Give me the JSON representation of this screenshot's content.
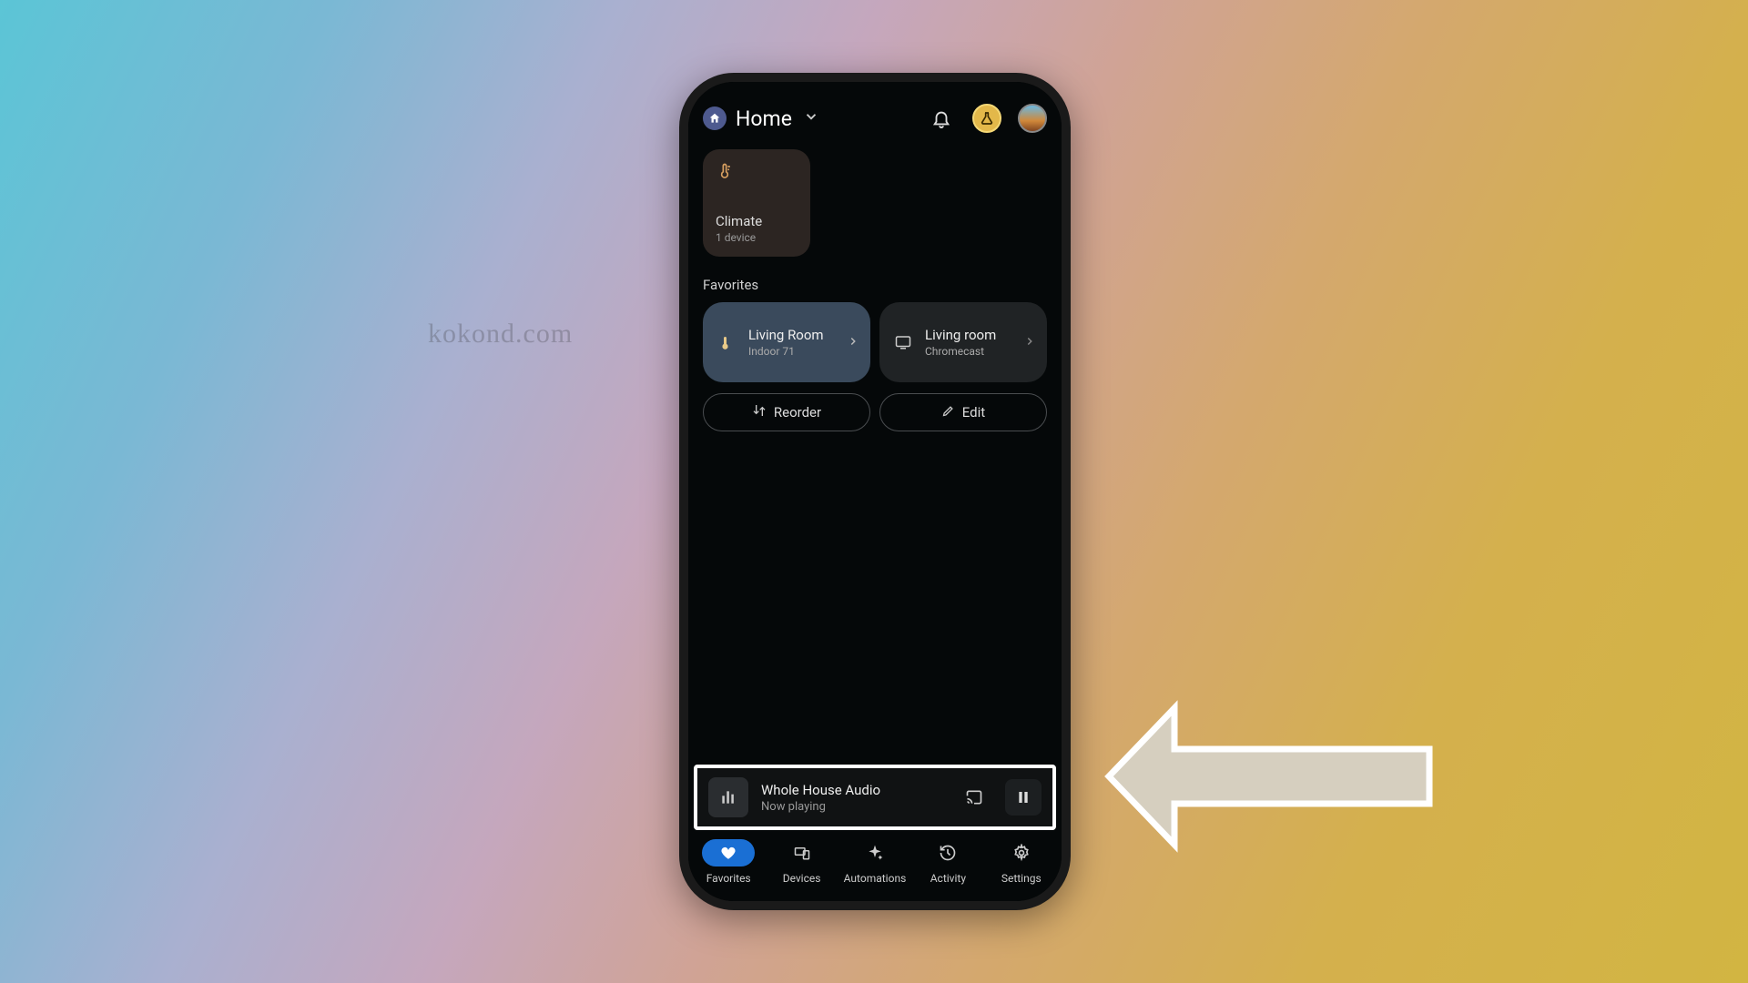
{
  "watermark": "kokond.com",
  "header": {
    "title": "Home"
  },
  "climate": {
    "label": "Climate",
    "sub": "1 device"
  },
  "favorites_label": "Favorites",
  "favorites": [
    {
      "title": "Living Room",
      "sub": "Indoor 71"
    },
    {
      "title": "Living room",
      "sub": "Chromecast"
    }
  ],
  "actions": {
    "reorder": "Reorder",
    "edit": "Edit"
  },
  "nowplaying": {
    "title": "Whole House Audio",
    "sub": "Now playing"
  },
  "nav": {
    "favorites": "Favorites",
    "devices": "Devices",
    "automations": "Automations",
    "activity": "Activity",
    "settings": "Settings"
  }
}
